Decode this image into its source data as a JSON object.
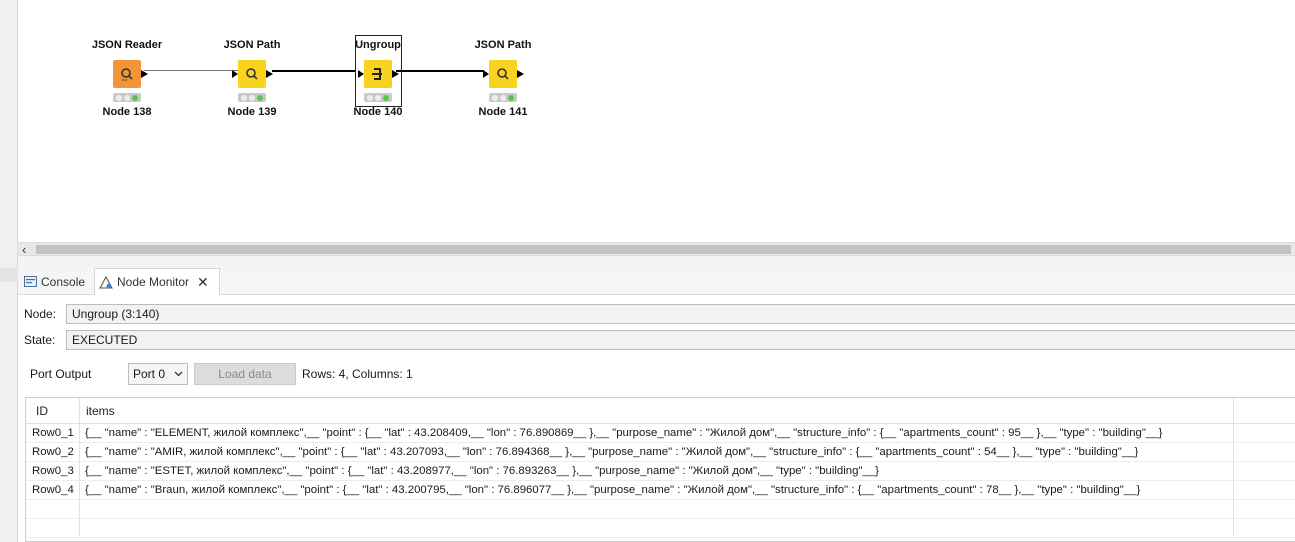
{
  "workflow": {
    "nodes": [
      {
        "title": "JSON Reader",
        "label": "Node 138",
        "icon": "json-reader-icon",
        "color": "#f39437"
      },
      {
        "title": "JSON Path",
        "label": "Node 139",
        "icon": "json-path-icon",
        "color": "#f8d21c"
      },
      {
        "title": "Ungroup",
        "label": "Node 140",
        "icon": "ungroup-icon",
        "color": "#f8d21c"
      },
      {
        "title": "JSON Path",
        "label": "Node 141",
        "icon": "json-path-icon",
        "color": "#f8d21c"
      }
    ]
  },
  "tabs": {
    "console": "Console",
    "node_monitor": "Node Monitor"
  },
  "monitor": {
    "node_label": "Node:",
    "node_value": "Ungroup  (3:140)",
    "state_label": "State:",
    "state_value": "EXECUTED",
    "port_output_label": "Port Output",
    "port_selected": "Port 0",
    "load_button": "Load data",
    "rows_info": "Rows: 4, Columns: 1"
  },
  "table": {
    "headers": [
      "ID",
      "items"
    ],
    "rows": [
      {
        "id": "Row0_1",
        "items": "{__ \"name\" : \"ELEMENT, жилой комплекс\",__ \"point\" : {__ \"lat\" : 43.208409,__ \"lon\" : 76.890869__ },__ \"purpose_name\" : \"Жилой дом\",__ \"structure_info\" : {__ \"apartments_count\" : 95__ },__ \"type\" : \"building\"__}"
      },
      {
        "id": "Row0_2",
        "items": "{__ \"name\" : \"AMIR, жилой комплекс\",__ \"point\" : {__ \"lat\" : 43.207093,__ \"lon\" : 76.894368__ },__ \"purpose_name\" : \"Жилой дом\",__ \"structure_info\" : {__ \"apartments_count\" : 54__ },__ \"type\" : \"building\"__}"
      },
      {
        "id": "Row0_3",
        "items": "{__ \"name\" : \"ESTET, жилой комплекс\",__ \"point\" : {__ \"lat\" : 43.208977,__ \"lon\" : 76.893263__ },__ \"purpose_name\" : \"Жилой дом\",__ \"type\" : \"building\"__}"
      },
      {
        "id": "Row0_4",
        "items": "{__ \"name\" : \"Braun, жилой комплекс\",__ \"point\" : {__ \"lat\" : 43.200795,__ \"lon\" : 76.896077__ },__ \"purpose_name\" : \"Жилой дом\",__ \"structure_info\" : {__ \"apartments_count\" : 78__ },__ \"type\" : \"building\"__}"
      }
    ]
  }
}
